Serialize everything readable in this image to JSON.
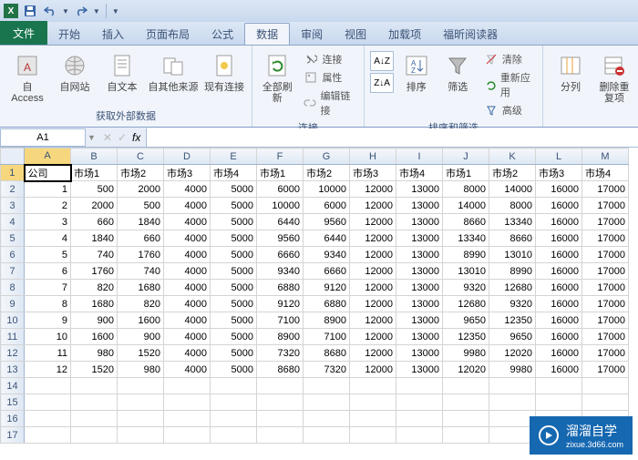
{
  "qat": {
    "save": "保存",
    "undo": "撤销",
    "redo": "重做"
  },
  "tabs": {
    "file": "文件",
    "items": [
      "开始",
      "插入",
      "页面布局",
      "公式",
      "数据",
      "审阅",
      "视图",
      "加载项",
      "福昕阅读器"
    ],
    "active": 4
  },
  "ribbon": {
    "group_external": {
      "label": "获取外部数据",
      "access": "自 Access",
      "web": "自网站",
      "text": "自文本",
      "other": "自其他来源",
      "existing": "现有连接"
    },
    "group_conn": {
      "label": "连接",
      "refresh": "全部刷新",
      "conn": "连接",
      "prop": "属性",
      "edit": "编辑链接"
    },
    "group_sort": {
      "label": "排序和筛选",
      "sort": "排序",
      "filter": "筛选",
      "clear": "清除",
      "reapply": "重新应用",
      "adv": "高级"
    },
    "group_tools": {
      "texttocol": "分列",
      "dedup": "删除重复项"
    }
  },
  "formula_bar": {
    "cell_ref": "A1",
    "fx": "fx"
  },
  "columns": [
    "A",
    "B",
    "C",
    "D",
    "E",
    "F",
    "G",
    "H",
    "I",
    "J",
    "K",
    "L",
    "M"
  ],
  "headers": [
    "公司",
    "市场1",
    "市场2",
    "市场3",
    "市场4",
    "市场1",
    "市场2",
    "市场3",
    "市场4",
    "市场1",
    "市场2",
    "市场3",
    "市场4"
  ],
  "rows": [
    [
      1,
      500,
      2000,
      4000,
      5000,
      6000,
      10000,
      12000,
      13000,
      8000,
      14000,
      16000,
      17000
    ],
    [
      2,
      2000,
      500,
      4000,
      5000,
      10000,
      6000,
      12000,
      13000,
      14000,
      8000,
      16000,
      17000
    ],
    [
      3,
      660,
      1840,
      4000,
      5000,
      6440,
      9560,
      12000,
      13000,
      8660,
      13340,
      16000,
      17000
    ],
    [
      4,
      1840,
      660,
      4000,
      5000,
      9560,
      6440,
      12000,
      13000,
      13340,
      8660,
      16000,
      17000
    ],
    [
      5,
      740,
      1760,
      4000,
      5000,
      6660,
      9340,
      12000,
      13000,
      8990,
      13010,
      16000,
      17000
    ],
    [
      6,
      1760,
      740,
      4000,
      5000,
      9340,
      6660,
      12000,
      13000,
      13010,
      8990,
      16000,
      17000
    ],
    [
      7,
      820,
      1680,
      4000,
      5000,
      6880,
      9120,
      12000,
      13000,
      9320,
      12680,
      16000,
      17000
    ],
    [
      8,
      1680,
      820,
      4000,
      5000,
      9120,
      6880,
      12000,
      13000,
      12680,
      9320,
      16000,
      17000
    ],
    [
      9,
      900,
      1600,
      4000,
      5000,
      7100,
      8900,
      12000,
      13000,
      9650,
      12350,
      16000,
      17000
    ],
    [
      10,
      1600,
      900,
      4000,
      5000,
      8900,
      7100,
      12000,
      13000,
      12350,
      9650,
      16000,
      17000
    ],
    [
      11,
      980,
      1520,
      4000,
      5000,
      7320,
      8680,
      12000,
      13000,
      9980,
      12020,
      16000,
      17000
    ],
    [
      12,
      1520,
      980,
      4000,
      5000,
      8680,
      7320,
      12000,
      13000,
      12020,
      9980,
      16000,
      17000
    ]
  ],
  "empty_rows": [
    14,
    15,
    16,
    17
  ],
  "watermark": {
    "main": "溜溜自学",
    "sub": "zixue.3d66.com"
  }
}
